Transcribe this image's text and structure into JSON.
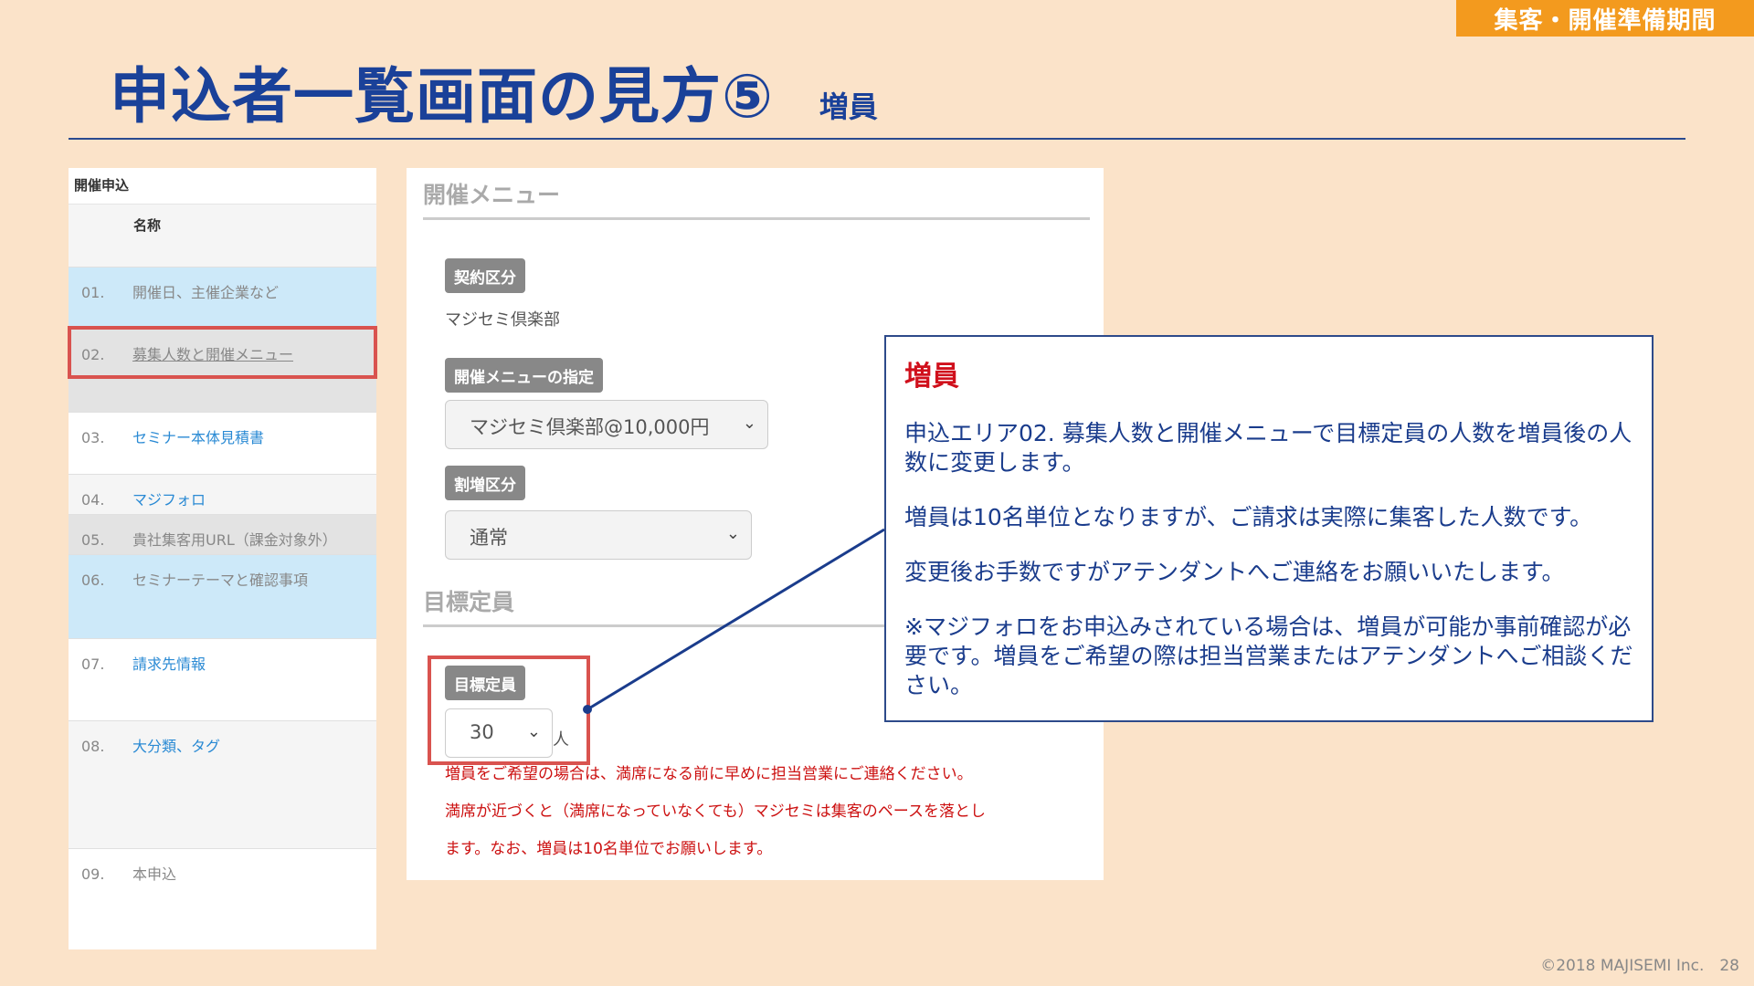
{
  "tag": "集客・開催準備期間",
  "title": "申込者一覧画面の見方⑤",
  "subtitle": "増員",
  "nav": {
    "header": "開催申込",
    "column": "名称",
    "rows": [
      {
        "num": "01.",
        "label": "開催日、主催企業など"
      },
      {
        "num": "02.",
        "label": "募集人数と開催メニュー"
      },
      {
        "num": "03.",
        "label": "セミナー本体見積書"
      },
      {
        "num": "04.",
        "label": "マジフォロ"
      },
      {
        "num": "05.",
        "label": "貴社集客用URL（課金対象外）"
      },
      {
        "num": "06.",
        "label": "セミナーテーマと確認事項"
      },
      {
        "num": "07.",
        "label": "請求先情報"
      },
      {
        "num": "08.",
        "label": "大分類、タグ"
      },
      {
        "num": "09.",
        "label": "本申込"
      }
    ]
  },
  "form": {
    "menu_title": "開催メニュー",
    "contract_badge": "契約区分",
    "contract_value": "マジセミ倶楽部",
    "menu_badge": "開催メニューの指定",
    "menu_select": "マジセミ倶楽部@10,000円",
    "discount_badge": "割増区分",
    "discount_select": "通常",
    "target_title": "目標定員",
    "target_badge": "目標定員",
    "target_select": "30",
    "target_unit": "人",
    "note_line1": "増員をご希望の場合は、満席になる前に早めに担当営業にご連絡ください。",
    "note_line2": "満席が近づくと（満席になっていなくても）マジセミは集客のペースを落とし",
    "note_line3": "ます。なお、増員は10名単位でお願いします。"
  },
  "callout": {
    "title": "増員",
    "p1": "申込エリア02. 募集人数と開催メニューで目標定員の人数を増員後の人数に変更します。",
    "p2": "増員は10名単位となりますが、ご請求は実際に集客した人数です。",
    "p3": "変更後お手数ですがアテンダントへご連絡をお願いいたします。",
    "p4": "※マジフォロをお申込みされている場合は、増員が可能か事前確認が必要です。増員をご希望の際は担当営業またはアテンダントへご相談ください。"
  },
  "footer": "©2018 MAJISEMI Inc.　28",
  "colors": {
    "background": "#fbe3c9",
    "accent_orange": "#f39a1e",
    "title_blue": "#1a4199",
    "highlight_red": "#d9534f",
    "note_red": "#cc1111",
    "link_blue": "#2a8ad4"
  }
}
